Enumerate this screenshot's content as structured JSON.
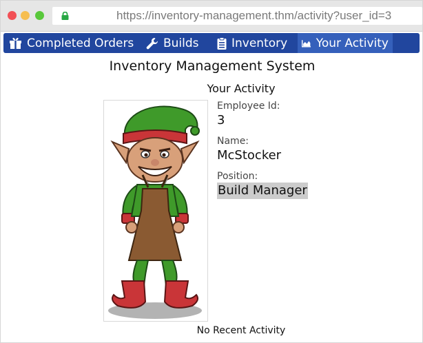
{
  "browser": {
    "url": "https://inventory-management.thm/activity?user_id=3"
  },
  "nav": {
    "items": [
      {
        "label": "Completed Orders",
        "icon": "gift-icon"
      },
      {
        "label": "Builds",
        "icon": "wrench-icon"
      },
      {
        "label": "Inventory",
        "icon": "clipboard-icon"
      },
      {
        "label": "Your Activity",
        "icon": "area-chart-icon",
        "active": true
      }
    ]
  },
  "page": {
    "title": "Inventory Management System",
    "section_title": "Your Activity"
  },
  "profile": {
    "employee_id_label": "Employee Id:",
    "employee_id": "3",
    "name_label": "Name:",
    "name": "McStocker",
    "position_label": "Position:",
    "position": "Build Manager"
  },
  "activity": {
    "empty_text": "No Recent Activity"
  },
  "colors": {
    "navbar": "#21469e",
    "nav_active": "#3560bb",
    "position_highlight": "#cccccc"
  }
}
